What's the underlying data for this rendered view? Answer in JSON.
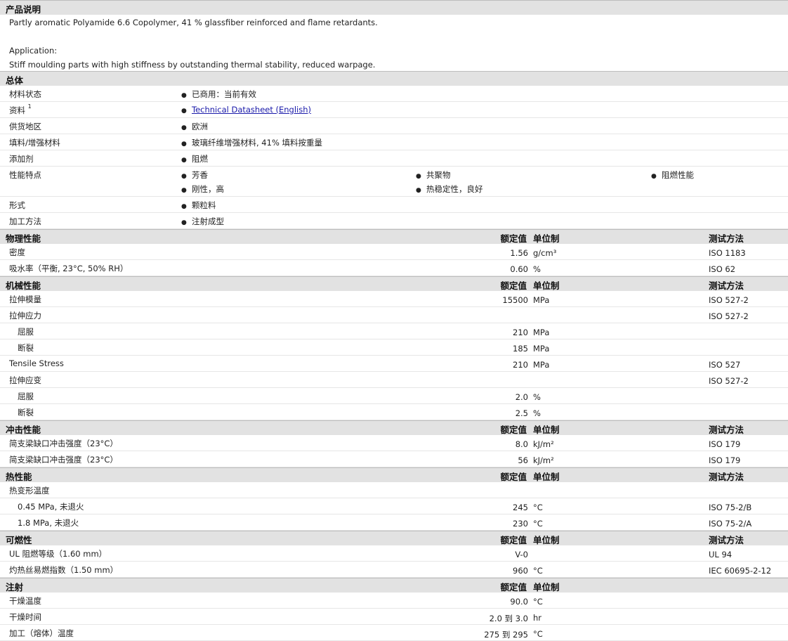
{
  "sections": {
    "description": {
      "title": "产品说明",
      "lines": [
        "Partly aromatic Polyamide 6.6 Copolymer, 41 % glassfiber reinforced and flame retardants.",
        "Application:",
        "Stiff moulding parts with high stiffness by outstanding thermal stability, reduced warpage."
      ]
    },
    "general": {
      "title": "总体",
      "rows": [
        {
          "label": "材料状态",
          "values": [
            "已商用：当前有效"
          ]
        },
        {
          "label": "资料",
          "sup": "1",
          "link": "Technical Datasheet (English)"
        },
        {
          "label": "供货地区",
          "values": [
            "欧洲"
          ]
        },
        {
          "label": "填料/增强材料",
          "values": [
            "玻璃纤维增强材料, 41% 填料按重量"
          ]
        },
        {
          "label": "添加剂",
          "values": [
            "阻燃"
          ]
        },
        {
          "label": "性能特点",
          "values": [
            "芳香",
            "共聚物",
            "阻燃性能",
            "刚性，高",
            "热稳定性，良好"
          ]
        },
        {
          "label": "形式",
          "values": [
            "颗粒料"
          ]
        },
        {
          "label": "加工方法",
          "values": [
            "注射成型"
          ]
        }
      ]
    },
    "headers": {
      "nominal": "额定值",
      "unit": "单位制",
      "method": "测试方法"
    },
    "physical": {
      "title": "物理性能",
      "rows": [
        {
          "label": "密度",
          "nominal": "1.56",
          "unit": "g/cm³",
          "method": "ISO 1183"
        },
        {
          "label": "吸水率（平衡, 23°C, 50% RH）",
          "nominal": "0.60",
          "unit": "%",
          "method": "ISO 62"
        }
      ]
    },
    "mechanical": {
      "title": "机械性能",
      "rows": [
        {
          "label": "拉伸模量",
          "nominal": "15500",
          "unit": "MPa",
          "method": "ISO 527-2"
        },
        {
          "label": "拉伸应力",
          "nominal": "",
          "unit": "",
          "method": "ISO 527-2"
        },
        {
          "label": "屈服",
          "nominal": "210",
          "unit": "MPa",
          "method": "",
          "sub": true
        },
        {
          "label": "断裂",
          "nominal": "185",
          "unit": "MPa",
          "method": "",
          "sub": true
        },
        {
          "label": "Tensile Stress",
          "nominal": "210",
          "unit": "MPa",
          "method": "ISO 527"
        },
        {
          "label": "拉伸应变",
          "nominal": "",
          "unit": "",
          "method": "ISO 527-2"
        },
        {
          "label": "屈服",
          "nominal": "2.0",
          "unit": "%",
          "method": "",
          "sub": true
        },
        {
          "label": "断裂",
          "nominal": "2.5",
          "unit": "%",
          "method": "",
          "sub": true
        }
      ]
    },
    "impact": {
      "title": "冲击性能",
      "rows": [
        {
          "label": "简支梁缺口冲击强度（23°C）",
          "nominal": "8.0",
          "unit": "kJ/m²",
          "method": "ISO 179"
        },
        {
          "label": "简支梁缺口冲击强度（23°C）",
          "nominal": "56",
          "unit": "kJ/m²",
          "method": "ISO 179"
        }
      ]
    },
    "thermal": {
      "title": "热性能",
      "rows": [
        {
          "label": "热变形温度",
          "nominal": "",
          "unit": "",
          "method": ""
        },
        {
          "label": "0.45 MPa, 未退火",
          "nominal": "245",
          "unit": "°C",
          "method": "ISO 75-2/B",
          "sub": true
        },
        {
          "label": "1.8 MPa, 未退火",
          "nominal": "230",
          "unit": "°C",
          "method": "ISO 75-2/A",
          "sub": true
        }
      ]
    },
    "flammability": {
      "title": "可燃性",
      "rows": [
        {
          "label": "UL 阻燃等级（1.60 mm）",
          "nominal": "V-0",
          "unit": "",
          "method": "UL 94"
        },
        {
          "label": "灼热丝易燃指数（1.50 mm）",
          "nominal": "960",
          "unit": "°C",
          "method": "IEC 60695-2-12"
        }
      ]
    },
    "injection": {
      "title": "注射",
      "rows": [
        {
          "label": "干燥温度",
          "nominal": "90.0",
          "unit": "°C",
          "method": ""
        },
        {
          "label": "干燥时间",
          "nominal": "2.0 到 3.0",
          "unit": "hr",
          "method": ""
        },
        {
          "label": "加工（熔体）温度",
          "nominal": "275 到 295",
          "unit": "°C",
          "method": ""
        }
      ]
    }
  }
}
